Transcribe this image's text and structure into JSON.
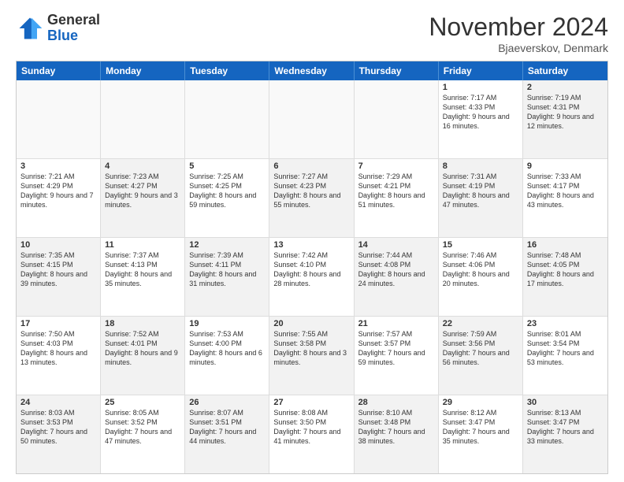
{
  "logo": {
    "general": "General",
    "blue": "Blue"
  },
  "title": "November 2024",
  "location": "Bjaeverskov, Denmark",
  "header_days": [
    "Sunday",
    "Monday",
    "Tuesday",
    "Wednesday",
    "Thursday",
    "Friday",
    "Saturday"
  ],
  "rows": [
    [
      {
        "day": "",
        "info": "",
        "empty": true
      },
      {
        "day": "",
        "info": "",
        "empty": true
      },
      {
        "day": "",
        "info": "",
        "empty": true
      },
      {
        "day": "",
        "info": "",
        "empty": true
      },
      {
        "day": "",
        "info": "",
        "empty": true
      },
      {
        "day": "1",
        "info": "Sunrise: 7:17 AM\nSunset: 4:33 PM\nDaylight: 9 hours and 16 minutes.",
        "empty": false
      },
      {
        "day": "2",
        "info": "Sunrise: 7:19 AM\nSunset: 4:31 PM\nDaylight: 9 hours and 12 minutes.",
        "empty": false,
        "shaded": true
      }
    ],
    [
      {
        "day": "3",
        "info": "Sunrise: 7:21 AM\nSunset: 4:29 PM\nDaylight: 9 hours and 7 minutes.",
        "empty": false
      },
      {
        "day": "4",
        "info": "Sunrise: 7:23 AM\nSunset: 4:27 PM\nDaylight: 9 hours and 3 minutes.",
        "empty": false,
        "shaded": true
      },
      {
        "day": "5",
        "info": "Sunrise: 7:25 AM\nSunset: 4:25 PM\nDaylight: 8 hours and 59 minutes.",
        "empty": false
      },
      {
        "day": "6",
        "info": "Sunrise: 7:27 AM\nSunset: 4:23 PM\nDaylight: 8 hours and 55 minutes.",
        "empty": false,
        "shaded": true
      },
      {
        "day": "7",
        "info": "Sunrise: 7:29 AM\nSunset: 4:21 PM\nDaylight: 8 hours and 51 minutes.",
        "empty": false
      },
      {
        "day": "8",
        "info": "Sunrise: 7:31 AM\nSunset: 4:19 PM\nDaylight: 8 hours and 47 minutes.",
        "empty": false,
        "shaded": true
      },
      {
        "day": "9",
        "info": "Sunrise: 7:33 AM\nSunset: 4:17 PM\nDaylight: 8 hours and 43 minutes.",
        "empty": false
      }
    ],
    [
      {
        "day": "10",
        "info": "Sunrise: 7:35 AM\nSunset: 4:15 PM\nDaylight: 8 hours and 39 minutes.",
        "empty": false,
        "shaded": true
      },
      {
        "day": "11",
        "info": "Sunrise: 7:37 AM\nSunset: 4:13 PM\nDaylight: 8 hours and 35 minutes.",
        "empty": false
      },
      {
        "day": "12",
        "info": "Sunrise: 7:39 AM\nSunset: 4:11 PM\nDaylight: 8 hours and 31 minutes.",
        "empty": false,
        "shaded": true
      },
      {
        "day": "13",
        "info": "Sunrise: 7:42 AM\nSunset: 4:10 PM\nDaylight: 8 hours and 28 minutes.",
        "empty": false
      },
      {
        "day": "14",
        "info": "Sunrise: 7:44 AM\nSunset: 4:08 PM\nDaylight: 8 hours and 24 minutes.",
        "empty": false,
        "shaded": true
      },
      {
        "day": "15",
        "info": "Sunrise: 7:46 AM\nSunset: 4:06 PM\nDaylight: 8 hours and 20 minutes.",
        "empty": false
      },
      {
        "day": "16",
        "info": "Sunrise: 7:48 AM\nSunset: 4:05 PM\nDaylight: 8 hours and 17 minutes.",
        "empty": false,
        "shaded": true
      }
    ],
    [
      {
        "day": "17",
        "info": "Sunrise: 7:50 AM\nSunset: 4:03 PM\nDaylight: 8 hours and 13 minutes.",
        "empty": false
      },
      {
        "day": "18",
        "info": "Sunrise: 7:52 AM\nSunset: 4:01 PM\nDaylight: 8 hours and 9 minutes.",
        "empty": false,
        "shaded": true
      },
      {
        "day": "19",
        "info": "Sunrise: 7:53 AM\nSunset: 4:00 PM\nDaylight: 8 hours and 6 minutes.",
        "empty": false
      },
      {
        "day": "20",
        "info": "Sunrise: 7:55 AM\nSunset: 3:58 PM\nDaylight: 8 hours and 3 minutes.",
        "empty": false,
        "shaded": true
      },
      {
        "day": "21",
        "info": "Sunrise: 7:57 AM\nSunset: 3:57 PM\nDaylight: 7 hours and 59 minutes.",
        "empty": false
      },
      {
        "day": "22",
        "info": "Sunrise: 7:59 AM\nSunset: 3:56 PM\nDaylight: 7 hours and 56 minutes.",
        "empty": false,
        "shaded": true
      },
      {
        "day": "23",
        "info": "Sunrise: 8:01 AM\nSunset: 3:54 PM\nDaylight: 7 hours and 53 minutes.",
        "empty": false
      }
    ],
    [
      {
        "day": "24",
        "info": "Sunrise: 8:03 AM\nSunset: 3:53 PM\nDaylight: 7 hours and 50 minutes.",
        "empty": false,
        "shaded": true
      },
      {
        "day": "25",
        "info": "Sunrise: 8:05 AM\nSunset: 3:52 PM\nDaylight: 7 hours and 47 minutes.",
        "empty": false
      },
      {
        "day": "26",
        "info": "Sunrise: 8:07 AM\nSunset: 3:51 PM\nDaylight: 7 hours and 44 minutes.",
        "empty": false,
        "shaded": true
      },
      {
        "day": "27",
        "info": "Sunrise: 8:08 AM\nSunset: 3:50 PM\nDaylight: 7 hours and 41 minutes.",
        "empty": false
      },
      {
        "day": "28",
        "info": "Sunrise: 8:10 AM\nSunset: 3:48 PM\nDaylight: 7 hours and 38 minutes.",
        "empty": false,
        "shaded": true
      },
      {
        "day": "29",
        "info": "Sunrise: 8:12 AM\nSunset: 3:47 PM\nDaylight: 7 hours and 35 minutes.",
        "empty": false
      },
      {
        "day": "30",
        "info": "Sunrise: 8:13 AM\nSunset: 3:47 PM\nDaylight: 7 hours and 33 minutes.",
        "empty": false,
        "shaded": true
      }
    ]
  ]
}
